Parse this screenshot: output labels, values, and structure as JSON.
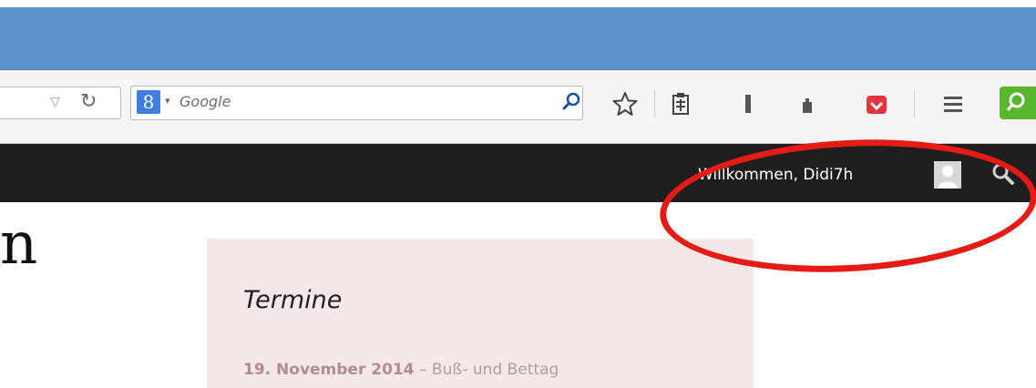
{
  "browser": {
    "search_engine_letter": "8",
    "search_placeholder": "Google"
  },
  "site_bar": {
    "welcome_text": "Willkommen, Didi7h"
  },
  "page": {
    "heading_fragment": "n",
    "widget": {
      "title": "Termine",
      "event_date": "19. November 2014",
      "event_separator": " – ",
      "event_name": "Buß- und Bettag"
    }
  },
  "colors": {
    "title_bar": "#5f93cd",
    "site_bar": "#1e1e1e",
    "widget_bg": "#f4e8e8",
    "annotation": "#e51b15",
    "addon_green": "#58b72c"
  },
  "icons": [
    "dropdown-arrow-icon",
    "reload-icon",
    "google-logo-icon",
    "search-engine-menu-icon",
    "search-go-icon",
    "bookmark-star-icon",
    "bookmarks-list-icon",
    "download-icon",
    "home-icon",
    "pocket-icon",
    "menu-icon",
    "addon-search-icon",
    "user-avatar-icon",
    "site-search-icon"
  ]
}
